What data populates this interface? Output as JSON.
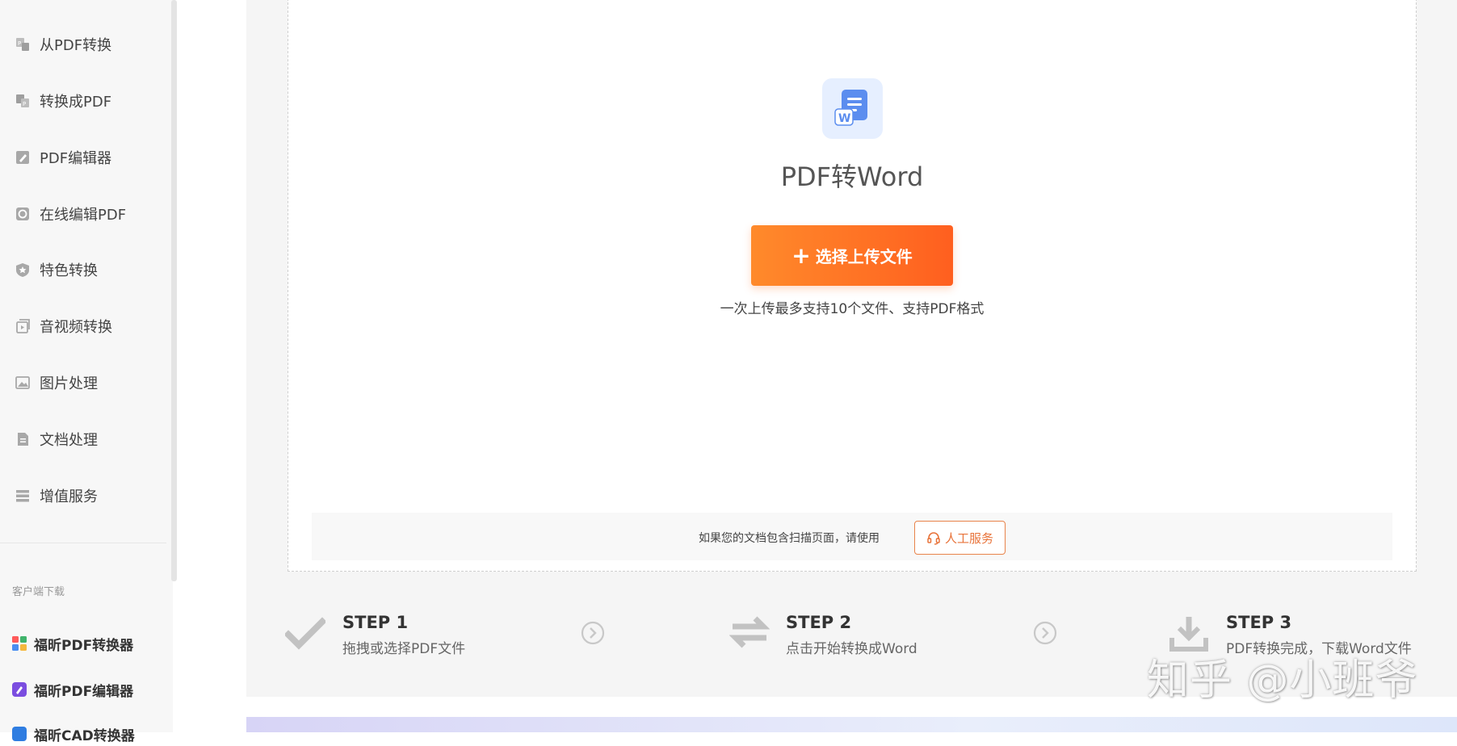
{
  "sidebar": {
    "items": [
      {
        "label": "从PDF转换",
        "icon": "pdf-convert-icon"
      },
      {
        "label": "转换成PDF",
        "icon": "to-pdf-icon"
      },
      {
        "label": "PDF编辑器",
        "icon": "pdf-editor-icon"
      },
      {
        "label": "在线编辑PDF",
        "icon": "online-edit-icon"
      },
      {
        "label": "特色转换",
        "icon": "star-shield-icon"
      },
      {
        "label": "音视频转换",
        "icon": "media-convert-icon"
      },
      {
        "label": "图片处理",
        "icon": "image-process-icon"
      },
      {
        "label": "文档处理",
        "icon": "document-icon"
      },
      {
        "label": "增值服务",
        "icon": "list-icon"
      }
    ],
    "download_section": "客户端下载",
    "downloads": [
      {
        "label": "福昕PDF转换器",
        "icon": "converter-app-icon"
      },
      {
        "label": "福昕PDF编辑器",
        "icon": "editor-app-icon"
      },
      {
        "label": "福昕CAD转换器",
        "icon": "cad-app-icon"
      }
    ]
  },
  "main": {
    "title": "PDF转Word",
    "upload_button": "选择上传文件",
    "upload_hint": "一次上传最多支持10个文件、支持PDF格式",
    "scan_text": "如果您的文档包含扫描页面，请使用",
    "service_button": "人工服务"
  },
  "steps": [
    {
      "title": "STEP 1",
      "desc": "拖拽或选择PDF文件",
      "icon": "checkmark-icon"
    },
    {
      "title": "STEP 2",
      "desc": "点击开始转换成Word",
      "icon": "swap-arrows-icon"
    },
    {
      "title": "STEP 3",
      "desc": "PDF转换完成，下载Word文件",
      "icon": "download-icon"
    }
  ],
  "watermark": "知乎 @小班爷",
  "colors": {
    "accent_orange": "#ff6a24",
    "icon_blue": "#5b8def",
    "sidebar_bg": "#f7f7f7"
  }
}
